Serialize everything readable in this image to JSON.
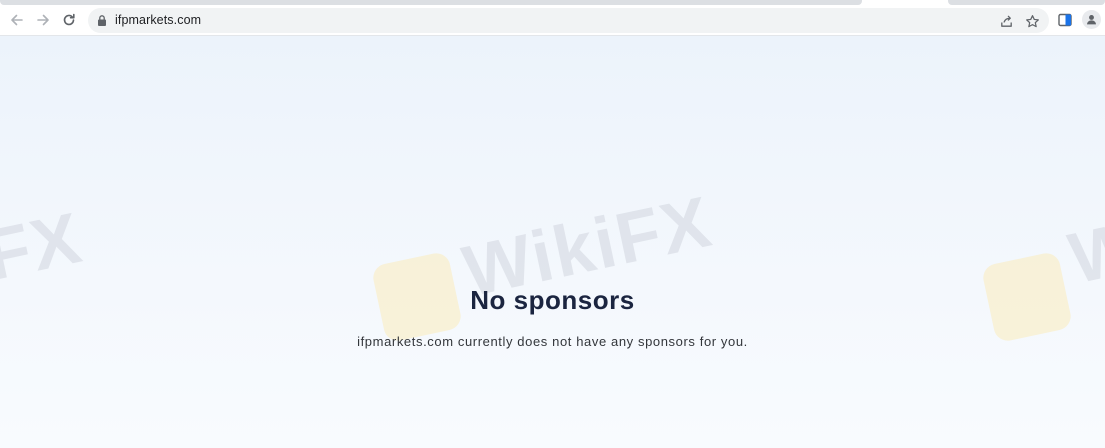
{
  "browser": {
    "url": "ifpmarkets.com",
    "icons": {
      "back": "arrow-left-icon",
      "forward": "arrow-right-icon",
      "reload": "reload-icon",
      "lock": "lock-icon",
      "share": "share-icon",
      "bookmark": "star-icon",
      "side_panel": "side-panel-icon",
      "profile": "profile-icon"
    }
  },
  "main": {
    "heading": "No sponsors",
    "message": "ifpmarkets.com currently does not have any sponsors for you."
  },
  "watermark": {
    "text": "WikiFX",
    "partial_left": "FX",
    "partial_right": "W"
  },
  "colors": {
    "heading": "#1b2540",
    "background": "#f3f8fd"
  }
}
